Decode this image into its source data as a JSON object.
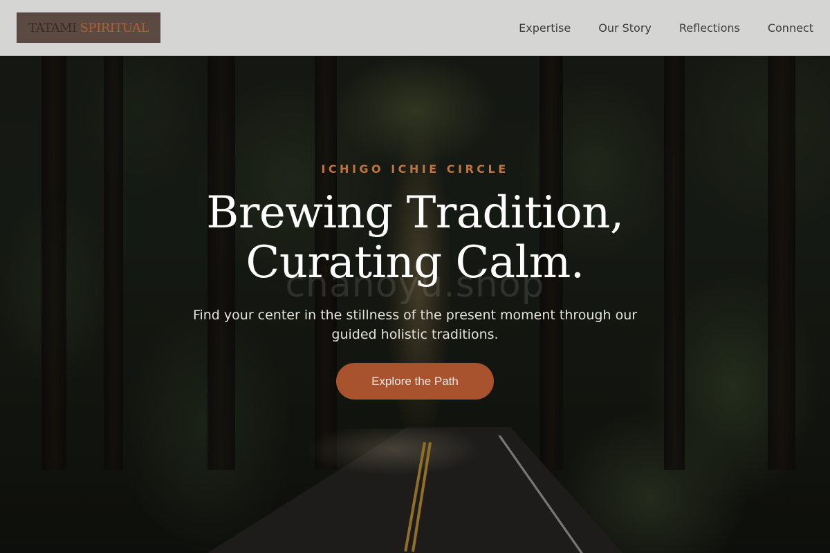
{
  "site": {
    "logo_part1": "TATAMI",
    "logo_part2": "SPIRITUAL"
  },
  "nav": {
    "items": [
      {
        "label": "Expertise"
      },
      {
        "label": "Our Story"
      },
      {
        "label": "Reflections"
      },
      {
        "label": "Connect"
      }
    ]
  },
  "hero": {
    "eyebrow": "ICHIGO ICHIE CIRCLE",
    "headline_line1": "Brewing Tradition,",
    "headline_line2": "Curating Calm.",
    "watermark": "chanoyu.shop",
    "subtitle": "Find your center in the stillness of the present moment through our guided holistic traditions.",
    "cta_label": "Explore the Path"
  },
  "colors": {
    "accent": "#a8532e",
    "eyebrow": "#c0753e",
    "header_bg": "#dededc"
  }
}
